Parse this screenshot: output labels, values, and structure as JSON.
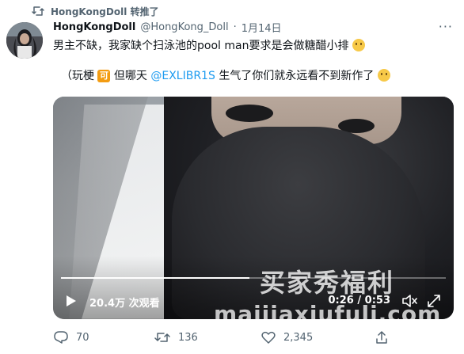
{
  "retweet": {
    "label": "HongKongDoll 转推了",
    "icon": "retweet-icon"
  },
  "tweet": {
    "author_name": "HongKongDoll",
    "handle": "@HongKong_Doll",
    "separator": "·",
    "date": "1月14日",
    "more": "···",
    "line1": "男主不缺，我家缺个扫泳池的pool man要求是会做糖醋小排",
    "line2_prefix": "（玩梗",
    "line2_badge": "可",
    "line2_mid": " 但哪天",
    "line2_mention": "@EXLIBR1S",
    "line2_suffix": "生气了你们就永远看不到新作了"
  },
  "video": {
    "views": "20.4万 次观看",
    "time": "0:26 / 0:53",
    "progress": 0.49,
    "watermark_zh": "买家秀福利",
    "watermark_url": "maijiaxiufuli.com"
  },
  "actions": {
    "reply_count": "70",
    "retweet_count": "136",
    "like_count": "2,345"
  },
  "colors": {
    "accent": "#1d9bf0",
    "muted": "#536471",
    "text": "#0f1419"
  }
}
